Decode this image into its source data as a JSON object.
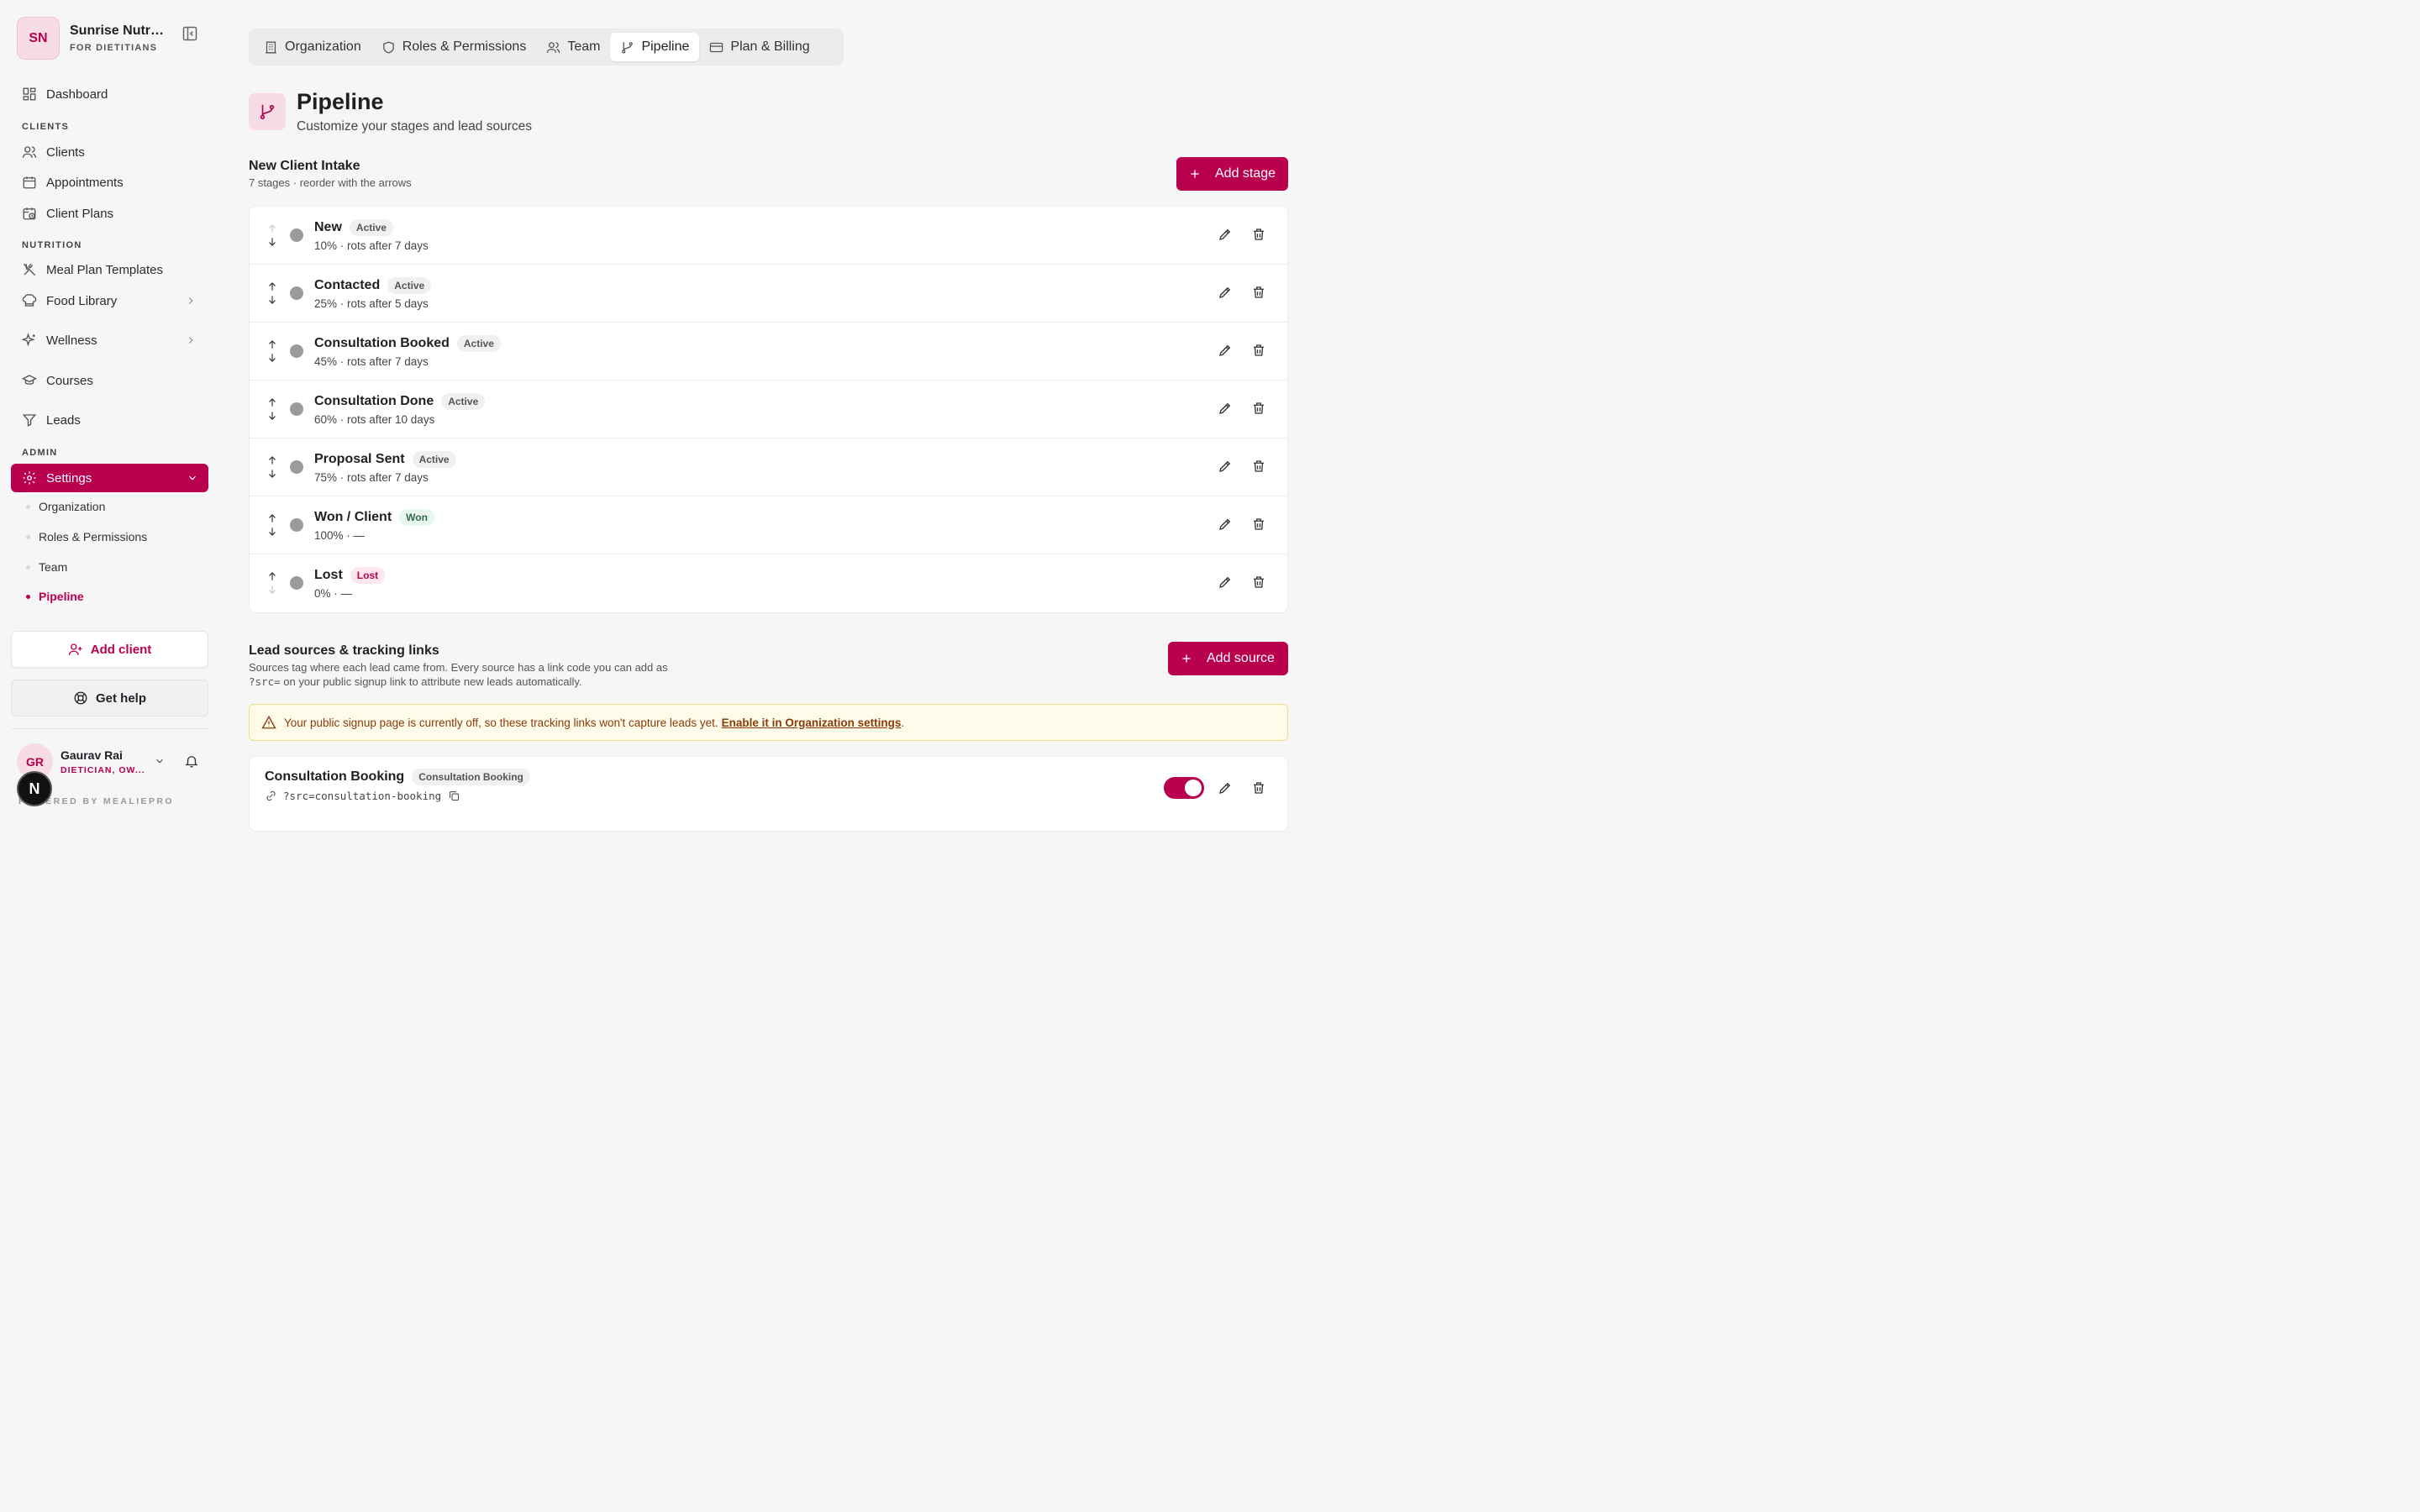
{
  "sidebar": {
    "org_initials": "SN",
    "org_name": "Sunrise Nutrition",
    "org_sub": "FOR DIETITIANS",
    "dashboard": "Dashboard",
    "section_clients": "CLIENTS",
    "clients": "Clients",
    "appointments": "Appointments",
    "client_plans": "Client Plans",
    "section_nutrition": "NUTRITION",
    "meal_plan_templates": "Meal Plan Templates",
    "food_library": "Food Library",
    "wellness": "Wellness",
    "courses": "Courses",
    "leads": "Leads",
    "section_admin": "ADMIN",
    "settings": "Settings",
    "settings_sub": [
      "Organization",
      "Roles & Permissions",
      "Team",
      "Pipeline"
    ],
    "add_client": "Add client",
    "get_help": "Get help",
    "user_initials": "GR",
    "user_name": "Gaurav Rai",
    "user_role": "DIETICIAN, OW...",
    "powered": "POWERED BY MEALIEPRO",
    "n_badge": "N"
  },
  "tabs": [
    "Organization",
    "Roles & Permissions",
    "Team",
    "Pipeline",
    "Plan & Billing"
  ],
  "header": {
    "title": "Pipeline",
    "subtitle": "Customize your stages and lead sources"
  },
  "pipeline": {
    "title": "New Client Intake",
    "desc": "7 stages · reorder with the arrows",
    "add_button": "Add stage",
    "stages": [
      {
        "name": "New",
        "badge": "Active",
        "meta": "10% · rots after 7 days"
      },
      {
        "name": "Contacted",
        "badge": "Active",
        "meta": "25% · rots after 5 days"
      },
      {
        "name": "Consultation Booked",
        "badge": "Active",
        "meta": "45% · rots after 7 days"
      },
      {
        "name": "Consultation Done",
        "badge": "Active",
        "meta": "60% · rots after 10 days"
      },
      {
        "name": "Proposal Sent",
        "badge": "Active",
        "meta": "75% · rots after 7 days"
      },
      {
        "name": "Won / Client",
        "badge": "Won",
        "meta": "100% · —"
      },
      {
        "name": "Lost",
        "badge": "Lost",
        "meta": "0% · —"
      }
    ]
  },
  "sources": {
    "title": "Lead sources & tracking links",
    "desc_1": "Sources tag where each lead came from. Every source has a link code you can add as",
    "desc_code": "?src=",
    "desc_2": " on your public signup link to attribute new leads automatically.",
    "add_button": "Add source",
    "warning_text": "Your public signup page is currently off, so these tracking links won't capture leads yet.",
    "warning_link": "Enable it in Organization settings",
    "warning_end": ".",
    "items": [
      {
        "name": "Consultation Booking",
        "badge": "Consultation Booking",
        "code": "?src=consultation-booking",
        "enabled": true
      }
    ]
  },
  "colors": {
    "accent": "#b8004f",
    "accent_soft": "#f7dbe5"
  }
}
